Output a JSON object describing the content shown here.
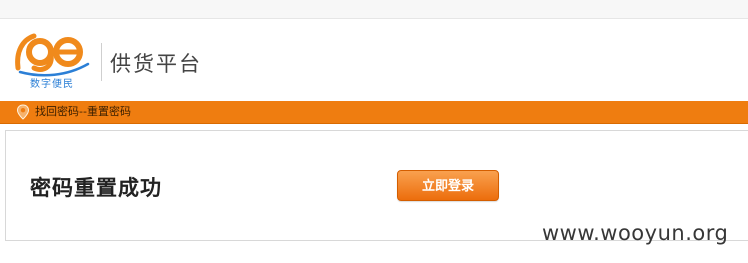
{
  "header": {
    "logo_tagline": "数字便民",
    "site_name": "供货平台"
  },
  "breadcrumb": {
    "text": "找回密码--重置密码"
  },
  "main": {
    "success_message": "密码重置成功",
    "login_button_label": "立即登录"
  },
  "watermark": {
    "text": "www.wooyun.org"
  },
  "colors": {
    "accent_orange": "#ef7d10",
    "logo_orange": "#f08a1c",
    "logo_blue": "#2b7fd6"
  },
  "icons": {
    "breadcrumb_icon": "location-pin-icon"
  }
}
